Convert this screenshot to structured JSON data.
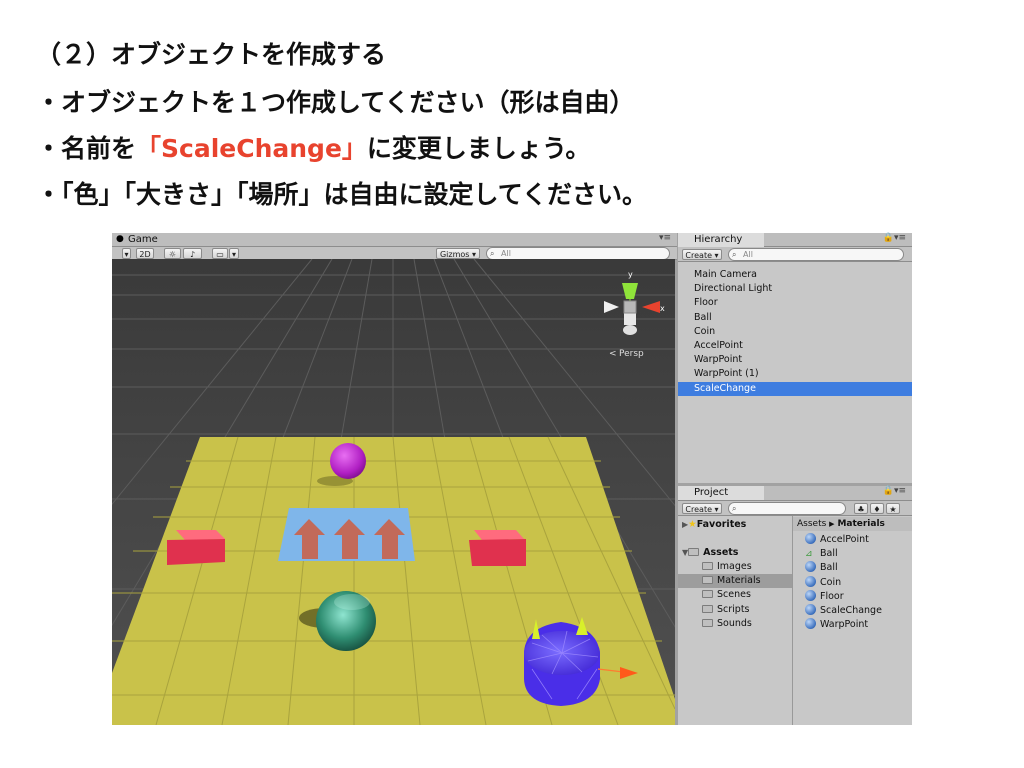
{
  "slide": {
    "heading": "（２）オブジェクトを作成する",
    "bullet1": "・オブジェクトを１つ作成してください（形は自由）",
    "bullet2_pre": "・名前を",
    "bullet2_name": "「ScaleChange」",
    "bullet2_post": "に変更しましょう。",
    "bullet3": "・「色」「大きさ」「場所」は自由に設定してください。"
  },
  "game": {
    "tab_label": "Game",
    "toolbar_2d": "2D",
    "gizmos_label": "Gizmos",
    "search_placeholder": "All",
    "gizmo_x": "x",
    "gizmo_y": "y",
    "persp_label": "Persp"
  },
  "hierarchy": {
    "tab_label": "Hierarchy",
    "create_label": "Create",
    "search_placeholder": "All",
    "items": [
      "Main Camera",
      "Directional Light",
      "Floor",
      "Ball",
      "Coin",
      "AccelPoint",
      "WarpPoint",
      "WarpPoint (1)",
      "ScaleChange"
    ],
    "selected": "ScaleChange"
  },
  "project": {
    "tab_label": "Project",
    "create_label": "Create",
    "favorites_label": "Favorites",
    "assets_label": "Assets",
    "folders": [
      "Images",
      "Materials",
      "Scenes",
      "Scripts",
      "Sounds"
    ],
    "selected_folder": "Materials",
    "breadcrumb_root": "Assets",
    "breadcrumb_current": "Materials",
    "materials": [
      "AccelPoint",
      "Ball",
      "Ball",
      "Coin",
      "Floor",
      "ScaleChange",
      "WarpPoint"
    ]
  },
  "colors": {
    "accent_text": "#e8432e",
    "selection": "#3e7de0",
    "floor": "#c9c24a",
    "cube": "#e23f55",
    "sphere": "#c52fd0",
    "coin": "#3aa689",
    "scale_change_object": "#5a3df0"
  }
}
